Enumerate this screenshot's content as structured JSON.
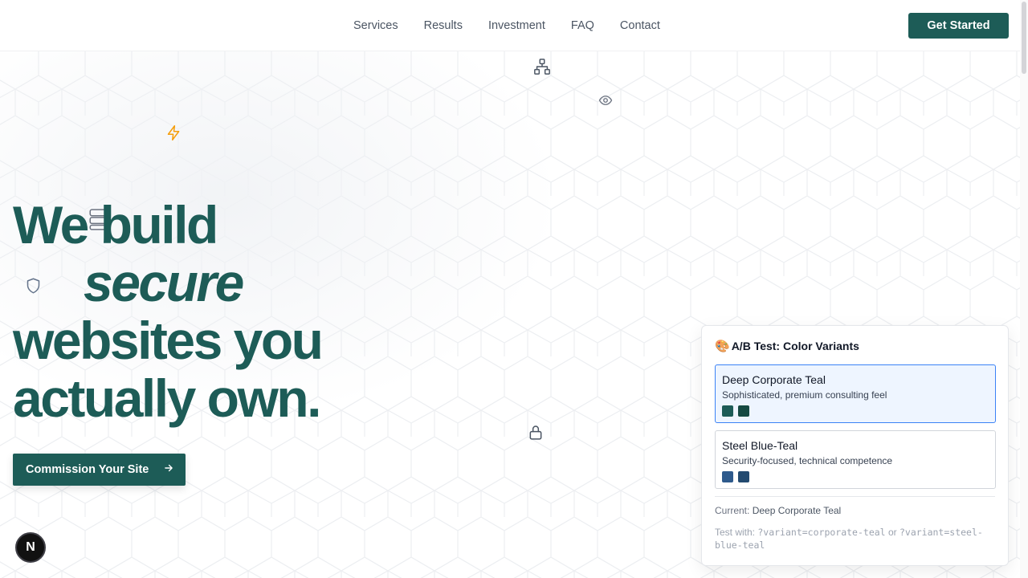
{
  "nav": {
    "items": [
      "Services",
      "Results",
      "Investment",
      "FAQ",
      "Contact"
    ],
    "cta_label": "Get Started"
  },
  "hero": {
    "line1": "We build",
    "line2": "secure",
    "line3": "websites you",
    "line4": "actually own.",
    "button_label": "Commission Your Site",
    "button_icon": "arrow-right-icon"
  },
  "decor_icons": [
    "network-icon",
    "eye-icon",
    "zap-icon",
    "server-icon",
    "shield-icon",
    "lock-icon"
  ],
  "badge": {
    "label": "N"
  },
  "ab_test": {
    "title_icon": "🎨",
    "title": "A/B Test: Color Variants",
    "variants": [
      {
        "name": "Deep Corporate Teal",
        "description": "Sophisticated, premium consulting feel",
        "colors": [
          "#1d5c57",
          "#164a42"
        ],
        "selected": true
      },
      {
        "name": "Steel Blue-Teal",
        "description": "Security-focused, technical competence",
        "colors": [
          "#2e5a8c",
          "#234a70"
        ],
        "selected": false
      }
    ],
    "current_label": "Current:",
    "current_value": "Deep Corporate Teal",
    "test_with_label": "Test with:",
    "test_with_param1": "?variant=corporate-teal",
    "test_with_or": "or",
    "test_with_param2": "?variant=steel-blue-teal"
  },
  "colors": {
    "brand": "#1d5c57",
    "accent_icon": "#f59e0b",
    "selected_border": "#3b82f6"
  }
}
